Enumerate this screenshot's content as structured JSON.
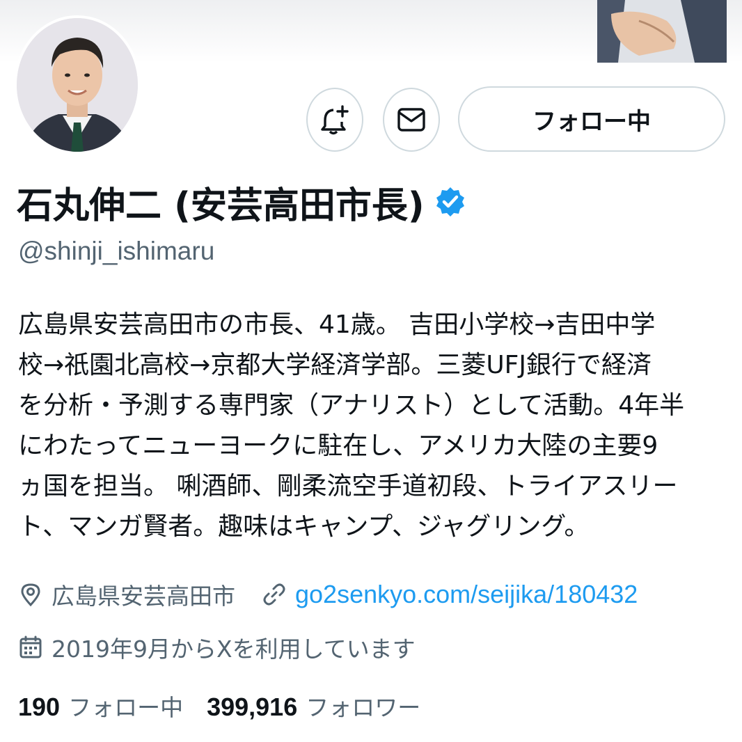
{
  "profile": {
    "display_name": "石丸伸二 (安芸高田市長)",
    "handle": "@shinji_ishimaru",
    "verified_icon": "verified-badge-icon",
    "accent_color": "#1d9bf0"
  },
  "actions": {
    "notify_icon": "bell-plus-icon",
    "message_icon": "envelope-icon",
    "follow_label": "フォロー中"
  },
  "bio": {
    "lines": [
      "広島県安芸高田市の市長、41歳。 吉田小学校→吉田中学",
      "校→祇園北高校→京都大学経済学部。三菱UFJ銀行で経済",
      "を分析・予測する専門家（アナリスト）として活動。4年半",
      "にわたってニューヨークに駐在し、アメリカ大陸の主要9",
      "ヵ国を担当。 唎酒師、剛柔流空手道初段、トライアスリー",
      "ト、マンガ賢者。趣味はキャンプ、ジャグリング。"
    ]
  },
  "meta": {
    "location": "広島県安芸高田市",
    "url": "go2senkyo.com/seijika/180432",
    "joined": "2019年9月からXを利用しています"
  },
  "stats": {
    "following_count": "190",
    "following_label": "フォロー中",
    "followers_count": "399,916",
    "followers_label": "フォロワー"
  }
}
